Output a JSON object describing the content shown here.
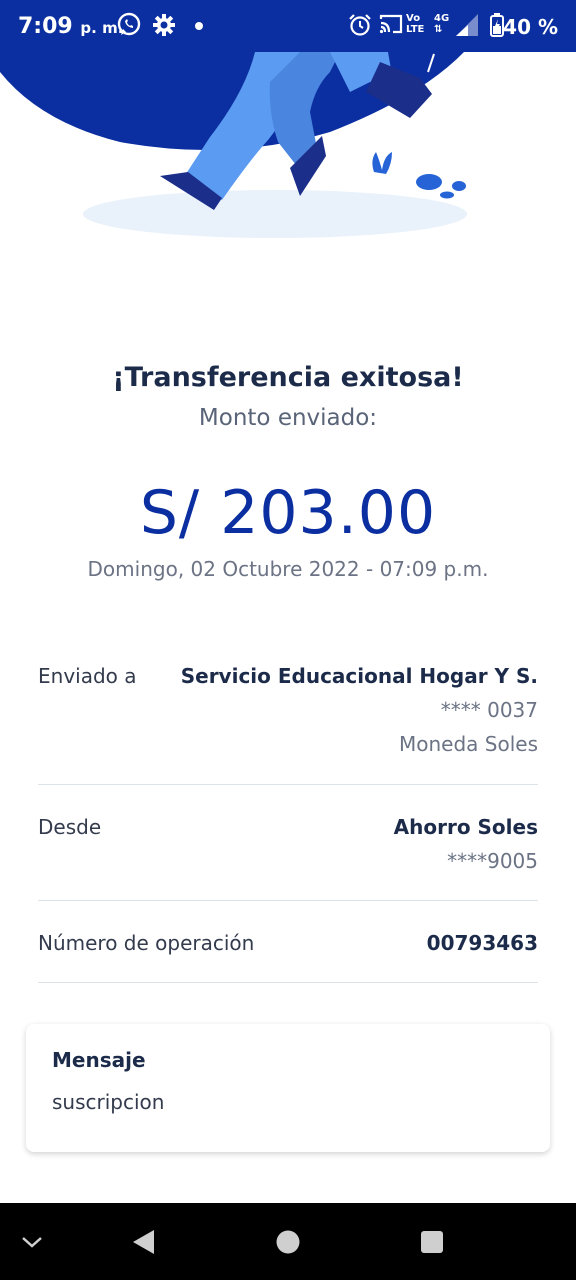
{
  "status_bar": {
    "time": "7:09",
    "ampm": "p. m.",
    "network_volte": "Vo LTE",
    "network_gen": "4G",
    "battery_percent": "40 %",
    "icons": [
      "whatsapp-icon",
      "settings-gear-icon",
      "dot-icon",
      "alarm-icon",
      "cast-icon",
      "volte-icon",
      "signal-icon",
      "battery-icon"
    ]
  },
  "receipt": {
    "title": "¡Transferencia exitosa!",
    "subtitle": "Monto enviado:",
    "amount": "S/ 203.00",
    "datetime": "Domingo, 02 Octubre 2022 - 07:09 p.m."
  },
  "details": {
    "sent_to": {
      "label": "Enviado a",
      "name": "Servicio Educacional Hogar Y S.",
      "account": "**** 0037",
      "currency": "Moneda Soles"
    },
    "from": {
      "label": "Desde",
      "account_type": "Ahorro Soles",
      "account": "****9005"
    },
    "operation": {
      "label": "Número de operación",
      "number": "00793463"
    }
  },
  "message": {
    "heading": "Mensaje",
    "body": "suscripcion"
  },
  "colors": {
    "brand_blue": "#0b2fa0",
    "light_blue": "#5b9cf2",
    "text_dark": "#1c2b4a",
    "text_muted": "#6b7385"
  },
  "nav_bar": {
    "buttons": [
      "chevron-down-icon",
      "back-icon",
      "home-icon",
      "recents-icon"
    ]
  }
}
